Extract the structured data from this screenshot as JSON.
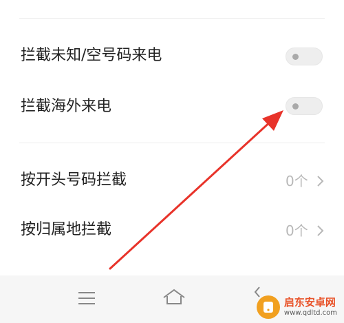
{
  "settings": {
    "rows": [
      {
        "label": "拦截未知/空号码来电",
        "enabled": false
      },
      {
        "label": "拦截海外来电",
        "enabled": false
      }
    ],
    "rules": [
      {
        "label": "按开头号码拦截",
        "value": "0个"
      },
      {
        "label": "按归属地拦截",
        "value": "0个"
      }
    ]
  },
  "annotation": {
    "color": "#e8332a"
  },
  "watermark": {
    "title": "启东安卓网",
    "url": "www.qdltd.com"
  }
}
